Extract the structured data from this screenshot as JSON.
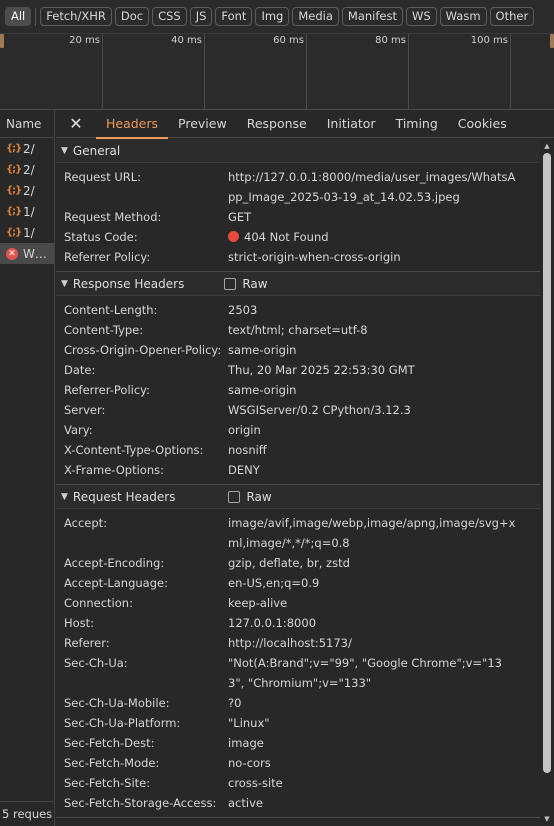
{
  "filters": [
    {
      "label": "All",
      "active": true
    },
    {
      "label": "Fetch/XHR"
    },
    {
      "label": "Doc"
    },
    {
      "label": "CSS"
    },
    {
      "label": "JS"
    },
    {
      "label": "Font"
    },
    {
      "label": "Img"
    },
    {
      "label": "Media"
    },
    {
      "label": "Manifest"
    },
    {
      "label": "WS"
    },
    {
      "label": "Wasm"
    },
    {
      "label": "Other"
    }
  ],
  "timeline": {
    "ticks": [
      "20 ms",
      "40 ms",
      "60 ms",
      "80 ms",
      "100 ms"
    ]
  },
  "request_list": {
    "header": "Name",
    "rows": [
      {
        "icon": "json-icon",
        "name": "2/"
      },
      {
        "icon": "json-icon",
        "name": "2/"
      },
      {
        "icon": "json-icon",
        "name": "2/"
      },
      {
        "icon": "json-icon",
        "name": "1/"
      },
      {
        "icon": "json-icon",
        "name": "1/"
      },
      {
        "icon": "error-icon",
        "name": "W…",
        "selected": true
      }
    ],
    "footer": "5 reques"
  },
  "tabs": [
    "Headers",
    "Preview",
    "Response",
    "Initiator",
    "Timing",
    "Cookies"
  ],
  "active_tab": "Headers",
  "general": {
    "title": "General",
    "request_url_label": "Request URL:",
    "request_url": "http://127.0.0.1:8000/media/user_images/WhatsApp_Image_2025-03-19_at_14.02.53.jpeg",
    "method_label": "Request Method:",
    "method": "GET",
    "status_label": "Status Code:",
    "status": "404 Not Found",
    "status_color": "#e84b3c",
    "referrer_label": "Referrer Policy:",
    "referrer": "strict-origin-when-cross-origin"
  },
  "response_headers": {
    "title": "Response Headers",
    "raw_label": "Raw",
    "rows": [
      {
        "k": "Content-Length:",
        "v": "2503"
      },
      {
        "k": "Content-Type:",
        "v": "text/html; charset=utf-8"
      },
      {
        "k": "Cross-Origin-Opener-Policy:",
        "v": "same-origin"
      },
      {
        "k": "Date:",
        "v": "Thu, 20 Mar 2025 22:53:30 GMT"
      },
      {
        "k": "Referrer-Policy:",
        "v": "same-origin"
      },
      {
        "k": "Server:",
        "v": "WSGIServer/0.2 CPython/3.12.3"
      },
      {
        "k": "Vary:",
        "v": "origin"
      },
      {
        "k": "X-Content-Type-Options:",
        "v": "nosniff"
      },
      {
        "k": "X-Frame-Options:",
        "v": "DENY"
      }
    ]
  },
  "request_headers": {
    "title": "Request Headers",
    "raw_label": "Raw",
    "rows": [
      {
        "k": "Accept:",
        "v": "image/avif,image/webp,image/apng,image/svg+xml,image/*,*/*;q=0.8"
      },
      {
        "k": "Accept-Encoding:",
        "v": "gzip, deflate, br, zstd"
      },
      {
        "k": "Accept-Language:",
        "v": "en-US,en;q=0.9"
      },
      {
        "k": "Connection:",
        "v": "keep-alive"
      },
      {
        "k": "Host:",
        "v": "127.0.0.1:8000"
      },
      {
        "k": "Referer:",
        "v": "http://localhost:5173/"
      },
      {
        "k": "Sec-Ch-Ua:",
        "v": "\"Not(A:Brand\";v=\"99\", \"Google Chrome\";v=\"133\", \"Chromium\";v=\"133\""
      },
      {
        "k": "Sec-Ch-Ua-Mobile:",
        "v": "?0"
      },
      {
        "k": "Sec-Ch-Ua-Platform:",
        "v": "\"Linux\""
      },
      {
        "k": "Sec-Fetch-Dest:",
        "v": "image"
      },
      {
        "k": "Sec-Fetch-Mode:",
        "v": "no-cors"
      },
      {
        "k": "Sec-Fetch-Site:",
        "v": "cross-site"
      },
      {
        "k": "Sec-Fetch-Storage-Access:",
        "v": "active"
      }
    ]
  }
}
